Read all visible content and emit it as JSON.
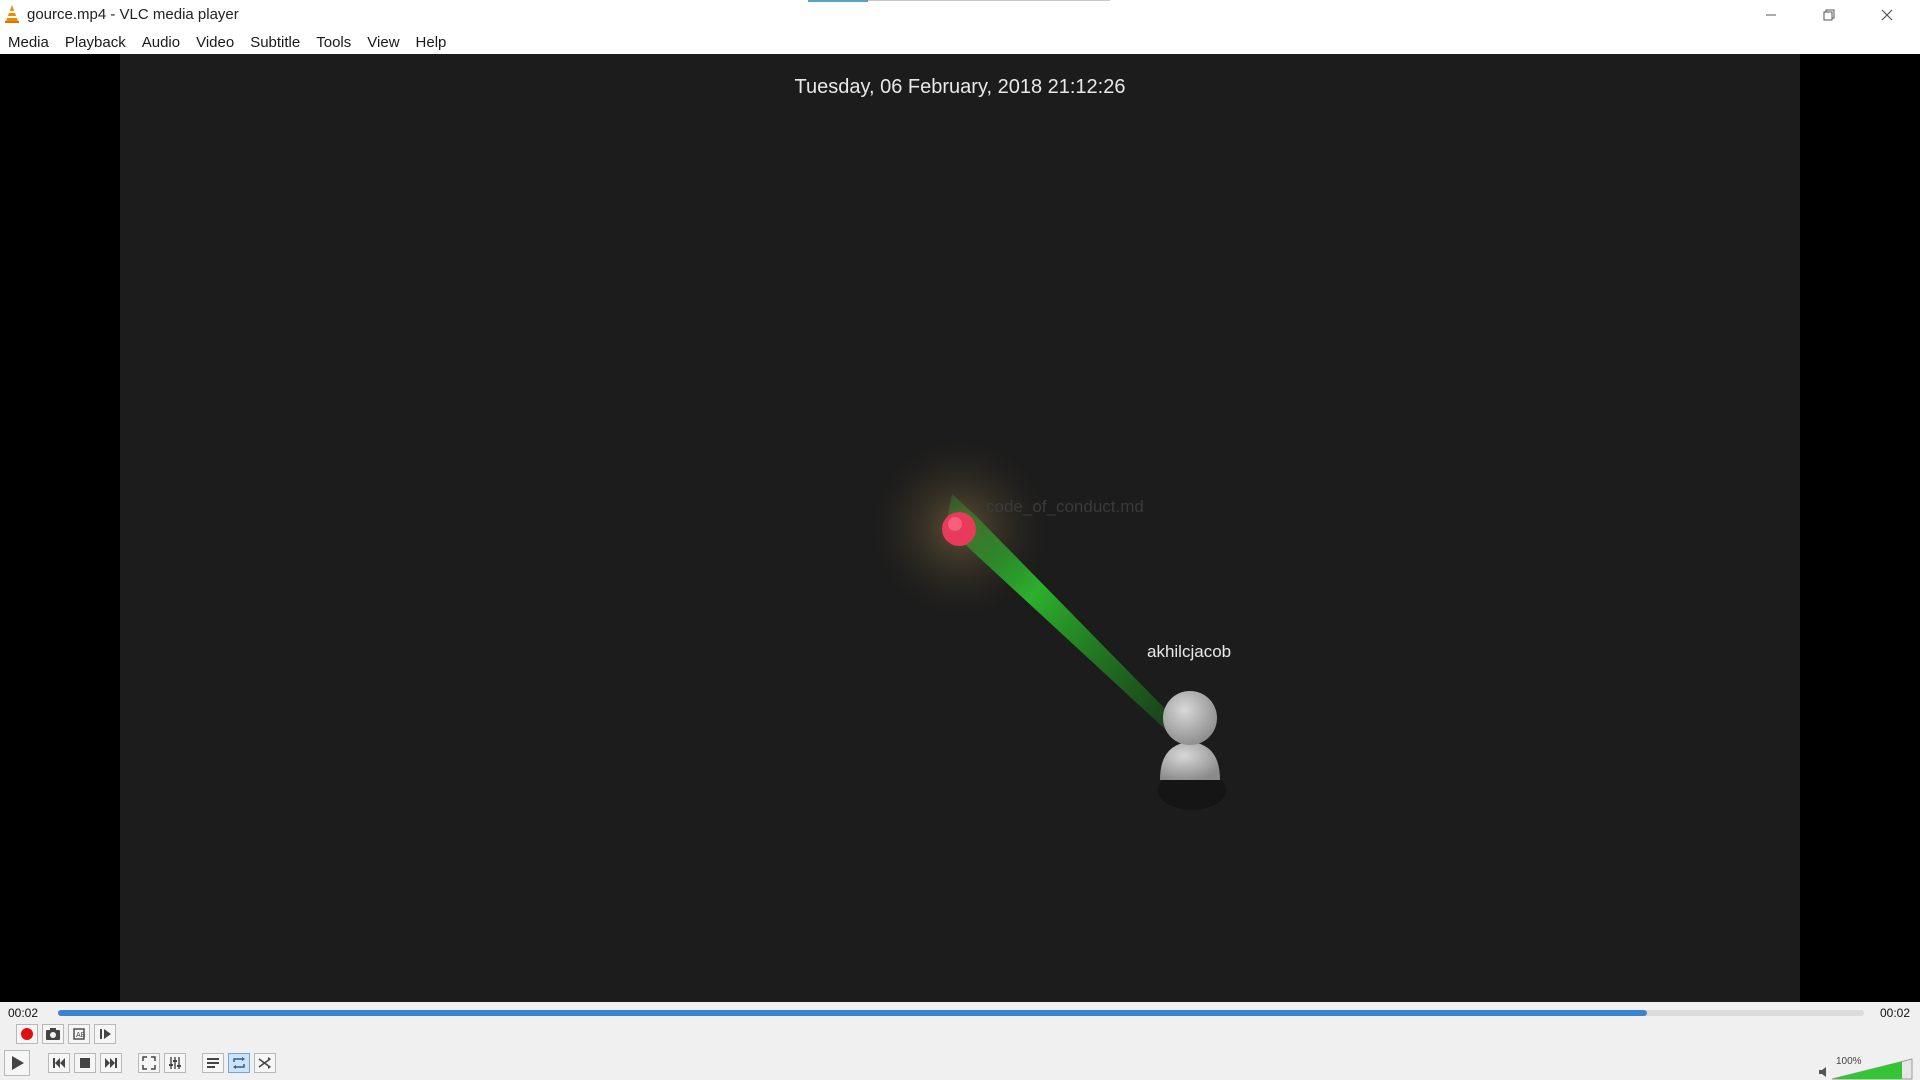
{
  "window": {
    "title": "gource.mp4 - VLC media player",
    "buttons": [
      "minimize",
      "restore",
      "close"
    ]
  },
  "menu": {
    "items": [
      "Media",
      "Playback",
      "Audio",
      "Video",
      "Subtitle",
      "Tools",
      "View",
      "Help"
    ]
  },
  "video": {
    "date_overlay": "Tuesday, 06 February, 2018 21:12:26",
    "file_label": "code_of_conduct.md",
    "user_label": "akhilcjacob",
    "colors": {
      "background": "#1c1c1c",
      "file_node": "#e83a5a",
      "beam": "#2eb82e",
      "user": "#bdbdbd"
    }
  },
  "playback": {
    "elapsed": "00:02",
    "total": "00:02",
    "progress_fraction": 0.88,
    "accent": "#3a83d1"
  },
  "controls": {
    "row1_icons": [
      "record-icon",
      "snapshot-icon",
      "loop-ab-icon",
      "frame-step-icon"
    ],
    "row2_icons": [
      "play-icon",
      "previous-icon",
      "stop-icon",
      "next-icon",
      "fullscreen-icon",
      "extended-settings-icon",
      "playlist-icon",
      "loop-icon",
      "shuffle-icon"
    ],
    "loop_active": true
  },
  "volume": {
    "label": "100%",
    "level_fraction": 1.0
  }
}
